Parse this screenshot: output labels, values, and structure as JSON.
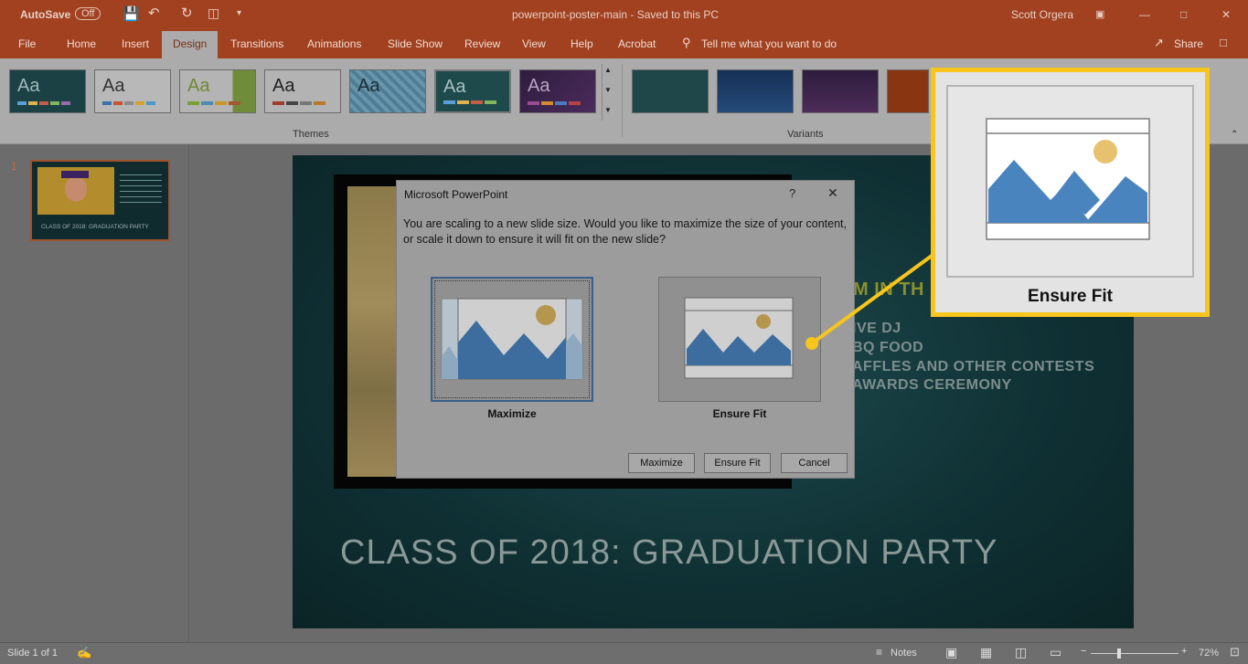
{
  "titlebar": {
    "autosave_label": "AutoSave",
    "autosave_state": "Off",
    "doc_title": "powerpoint-poster-main  -  Saved to this PC",
    "user": "Scott Orgera"
  },
  "tabs": [
    "File",
    "Home",
    "Insert",
    "Design",
    "Transitions",
    "Animations",
    "Slide Show",
    "Review",
    "View",
    "Help",
    "Acrobat"
  ],
  "active_tab": "Design",
  "tell_me": "Tell me what you want to do",
  "share": "Share",
  "ribbon": {
    "themes_label": "Themes",
    "variants_label": "Variants",
    "theme_glyph": "Aa"
  },
  "slide_pane": {
    "number": "1"
  },
  "slide": {
    "heading_partial": "M IN TH",
    "bullets": [
      "IVE DJ",
      "BQ FOOD",
      "AFFLES AND OTHER CONTESTS",
      "AWARDS CEREMONY"
    ],
    "title": "CLASS OF 2018:  GRADUATION PARTY",
    "thumb_title": "CLASS OF 2018:  GRADUATION PARTY"
  },
  "dialog": {
    "title": "Microsoft PowerPoint",
    "help": "?",
    "close": "✕",
    "message": "You are scaling to a new slide size.  Would you like to maximize the size of your content, or scale it down to ensure it will fit on the new slide?",
    "option_maximize": "Maximize",
    "option_ensure_fit": "Ensure Fit",
    "btn_maximize": "Maximize",
    "btn_ensure_fit": "Ensure Fit",
    "btn_cancel": "Cancel"
  },
  "callout": {
    "label": "Ensure Fit"
  },
  "status": {
    "slide_info": "Slide 1 of 1",
    "notes": "Notes",
    "zoom": "72%"
  },
  "colors": {
    "accent": "#a14120",
    "highlight": "#f7c51c",
    "mountain": "#4a84bf",
    "sun": "#e7c16d"
  }
}
